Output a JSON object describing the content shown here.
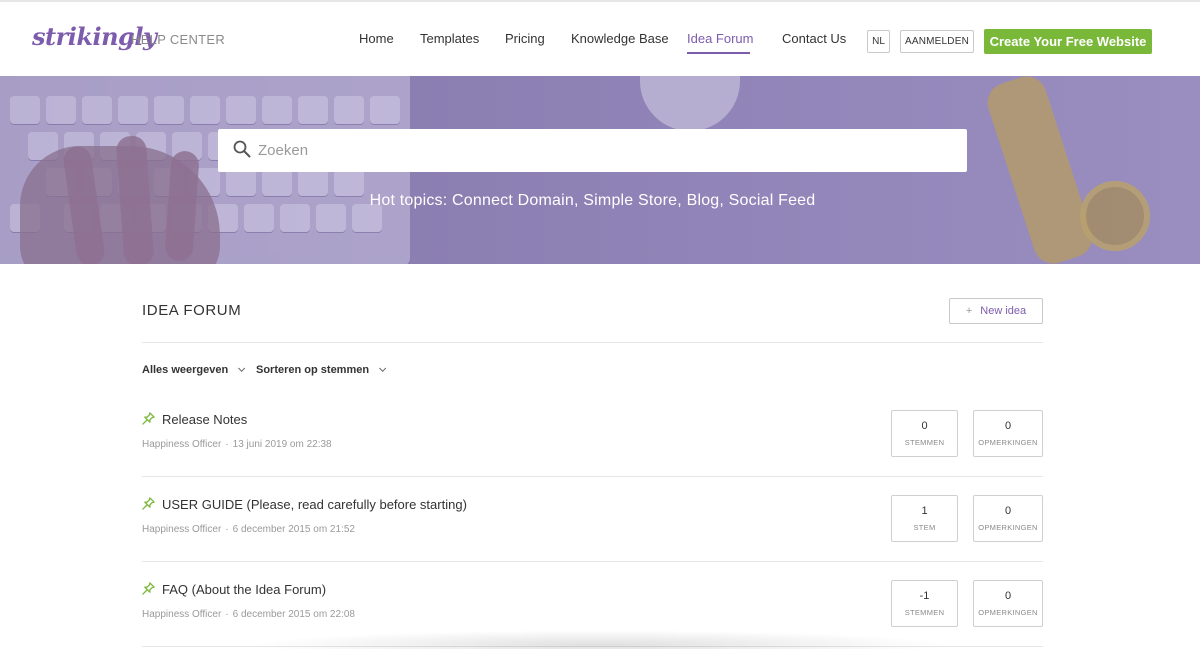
{
  "header": {
    "logo": "strikingly",
    "help_center": "HELP CENTER",
    "nav": [
      "Home",
      "Templates",
      "Pricing",
      "Knowledge Base",
      "Idea Forum",
      "Contact Us"
    ],
    "active_nav": "Idea Forum",
    "lang": "NL",
    "login": "AANMELDEN",
    "cta": "Create Your Free Website"
  },
  "colors": {
    "brand_purple": "#7e5cad",
    "cta_green": "#7ab83a",
    "pin_green": "#7ab83a",
    "hero_overlay": "#8a7db0"
  },
  "hero": {
    "search_placeholder": "Zoeken",
    "hot_topics": "Hot topics: Connect Domain, Simple Store, Blog, Social Feed"
  },
  "forum": {
    "title": "IDEA FORUM",
    "new_idea": "New idea",
    "filter_show": "Alles weergeven",
    "filter_sort": "Sorteren op stemmen",
    "posts": [
      {
        "title": "Release Notes",
        "author": "Happiness Officer",
        "date": "13 juni 2019 om 22:38",
        "votes": "0",
        "votes_label": "STEMMEN",
        "comments": "0",
        "comments_label": "OPMERKINGEN"
      },
      {
        "title": "USER GUIDE (Please, read carefully before starting)",
        "author": "Happiness Officer",
        "date": "6 december 2015 om 21:52",
        "votes": "1",
        "votes_label": "STEM",
        "comments": "0",
        "comments_label": "OPMERKINGEN"
      },
      {
        "title": "FAQ (About the Idea Forum)",
        "author": "Happiness Officer",
        "date": "6 december 2015 om 22:08",
        "votes": "-1",
        "votes_label": "STEMMEN",
        "comments": "0",
        "comments_label": "OPMERKINGEN"
      }
    ]
  },
  "icons": {
    "search": "magnifier",
    "pin": "pushpin",
    "chevron": "chevron-down",
    "plus": "+"
  }
}
